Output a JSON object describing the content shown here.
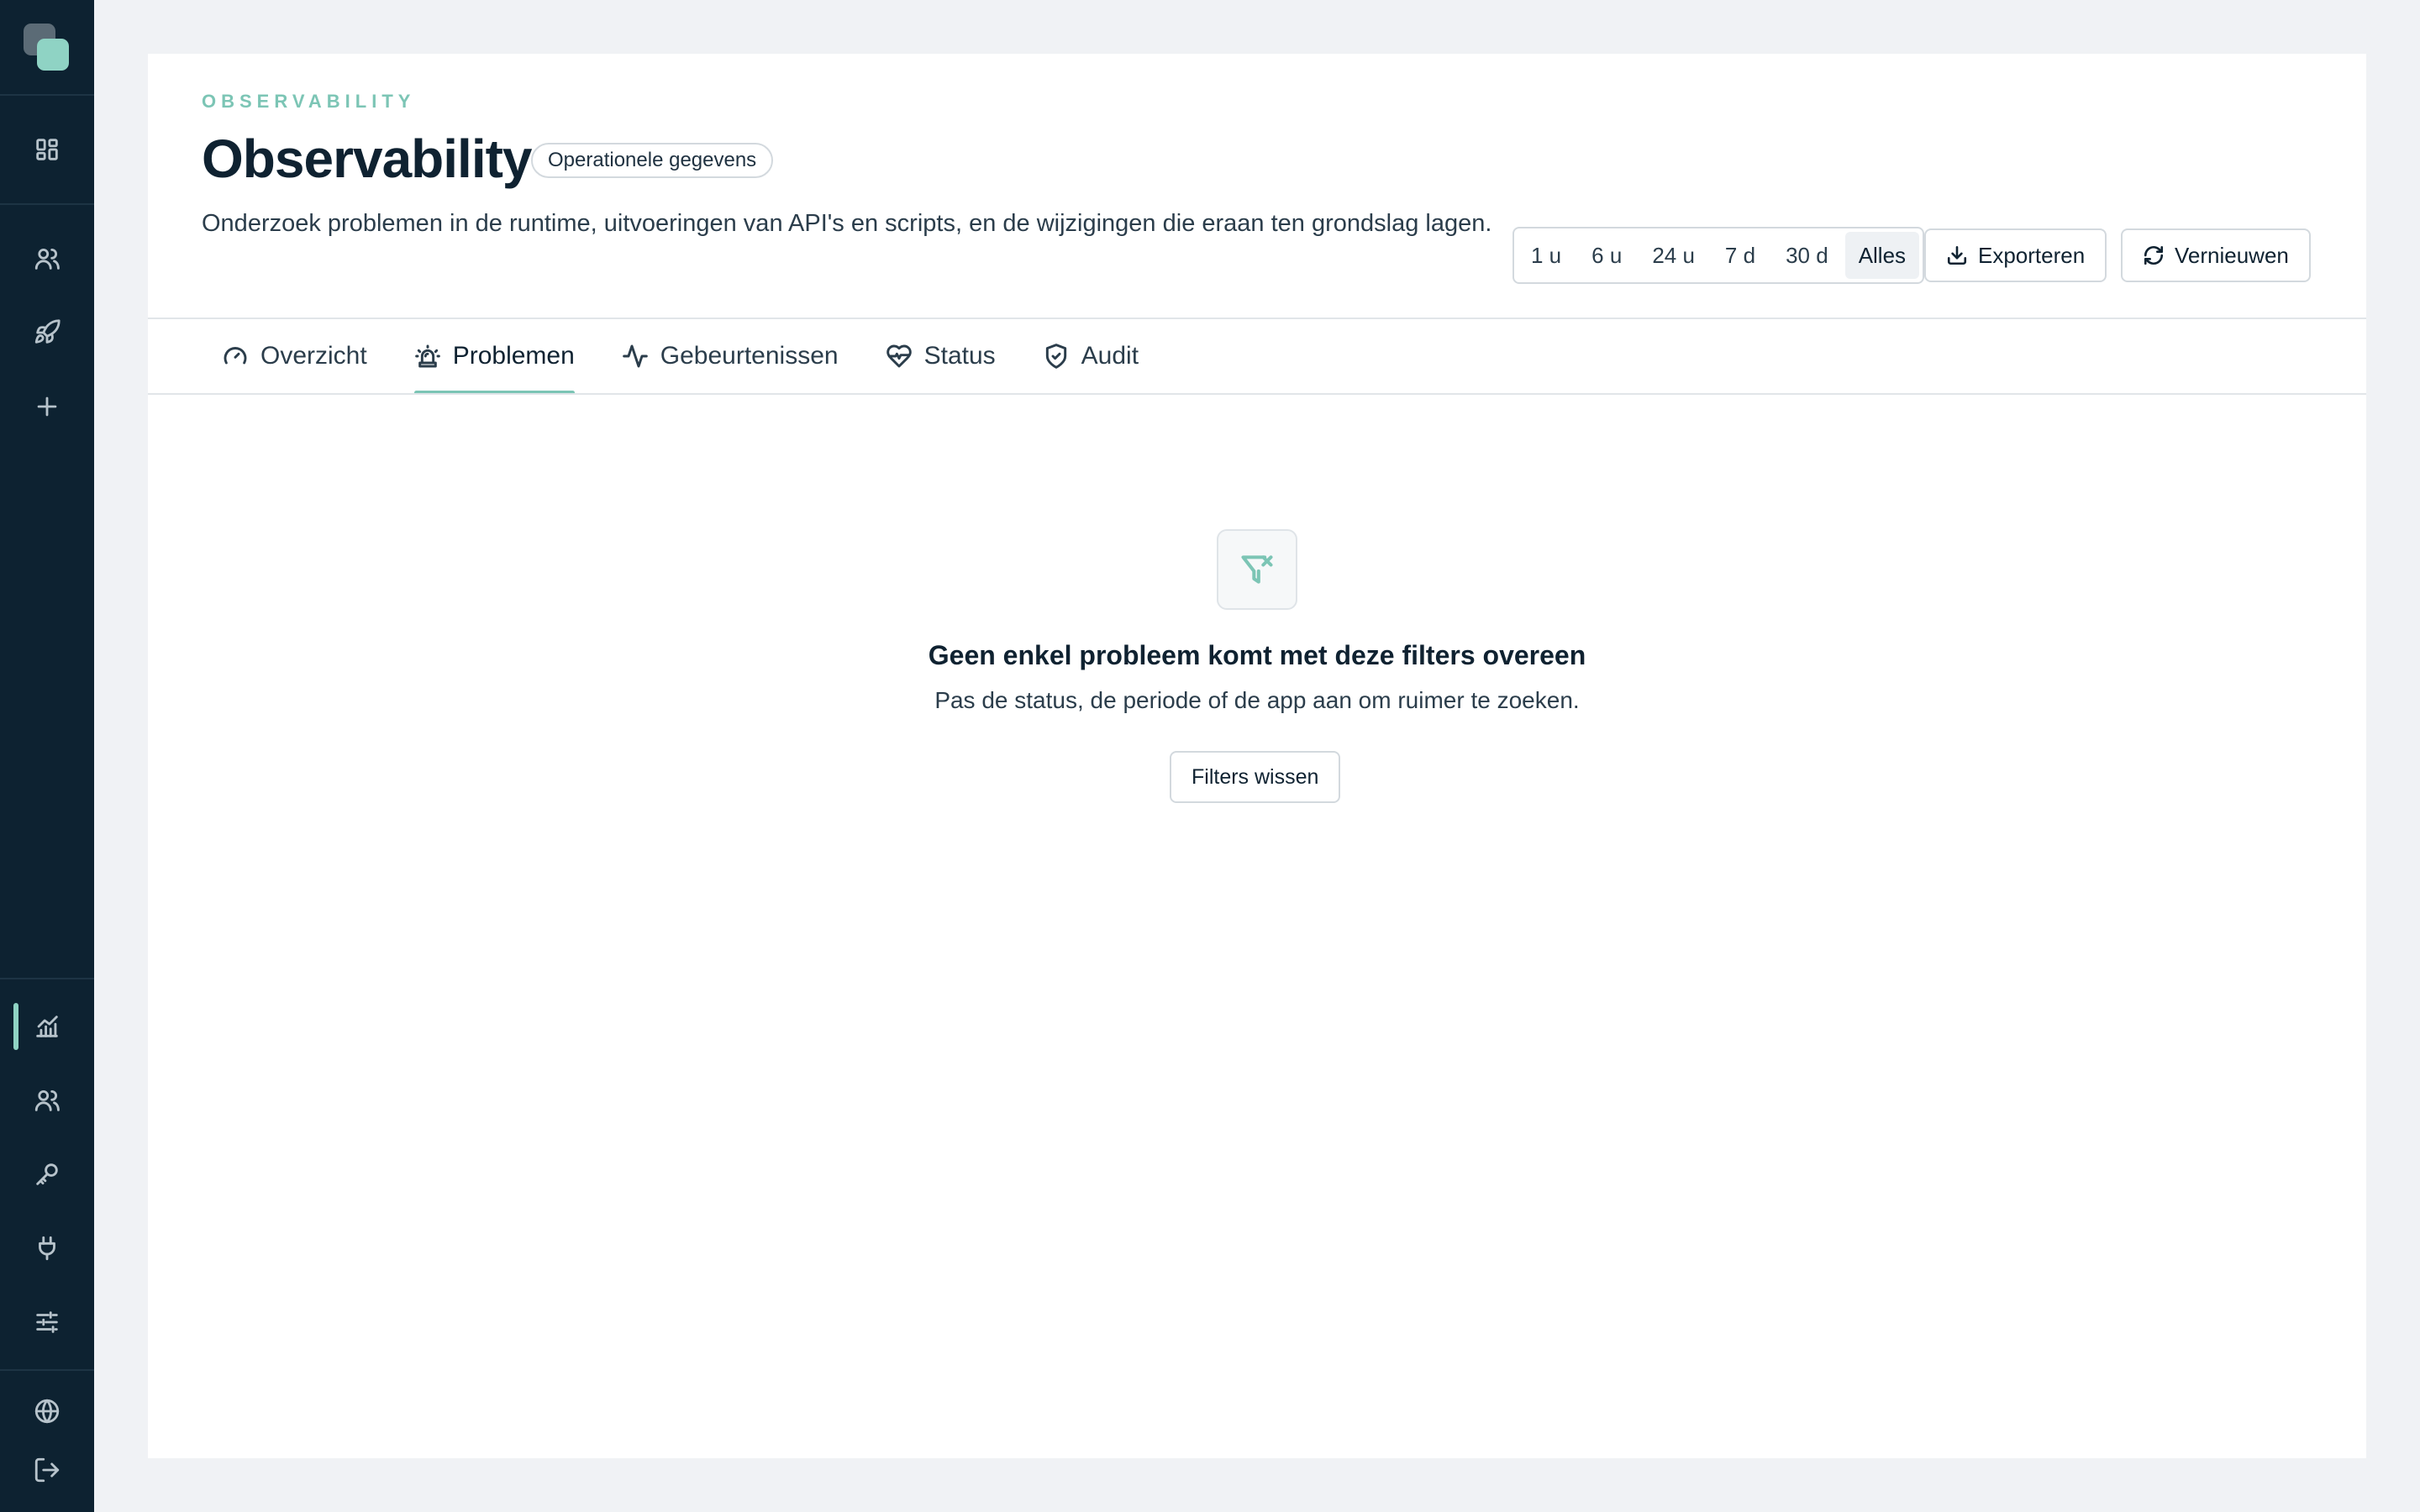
{
  "header": {
    "eyebrow": "OBSERVABILITY",
    "title": "Observability",
    "badge": "Operationele gegevens",
    "description": "Onderzoek problemen in de runtime, uitvoeringen van API's en scripts, en de wijzigingen die eraan ten grondslag lagen."
  },
  "time_range": {
    "options": [
      "1 u",
      "6 u",
      "24 u",
      "7 d",
      "30 d",
      "Alles"
    ],
    "selected": "Alles"
  },
  "actions": {
    "export_label": "Exporteren",
    "refresh_label": "Vernieuwen"
  },
  "tabs": [
    {
      "label": "Overzicht",
      "icon": "gauge-icon"
    },
    {
      "label": "Problemen",
      "icon": "siren-icon",
      "active": true
    },
    {
      "label": "Gebeurtenissen",
      "icon": "activity-icon"
    },
    {
      "label": "Status",
      "icon": "heart-pulse-icon"
    },
    {
      "label": "Audit",
      "icon": "shield-check-icon"
    }
  ],
  "empty_state": {
    "icon": "filter-x-icon",
    "title": "Geen enkel probleem komt met deze filters overeen",
    "subtitle": "Pas de status, de periode of de app aan om ruimer te zoeken.",
    "button_label": "Filters wissen"
  },
  "sidebar": {
    "icons": [
      "dashboard-icon",
      "users-icon",
      "rocket-icon",
      "plus-icon",
      "chart-icon",
      "team-icon",
      "key-icon",
      "plug-icon",
      "sliders-icon",
      "globe-icon",
      "logout-icon"
    ],
    "active": "chart-icon"
  },
  "colors": {
    "sidebar_bg": "#0d2231",
    "accent": "#7cc5b5",
    "page_bg": "#f0f2f5"
  }
}
